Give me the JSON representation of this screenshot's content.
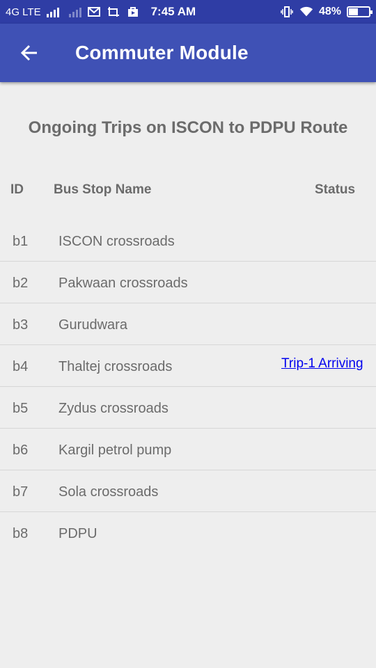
{
  "statusbar": {
    "network": "4G LTE",
    "time": "7:45 AM",
    "battery_percent": "48%",
    "battery_level": 0.48,
    "icons": [
      "signal-icon",
      "signal-dim-icon",
      "mail-icon",
      "screenshot-icon",
      "play-store-icon",
      "vibrate-icon",
      "wifi-icon",
      "battery-icon"
    ]
  },
  "appbar": {
    "title": "Commuter Module",
    "back_icon": "arrow-back-icon",
    "color": "#3f51b5"
  },
  "heading": "Ongoing Trips on ISCON to PDPU Route",
  "table": {
    "headers": {
      "id": "ID",
      "name": "Bus Stop Name",
      "status": "Status"
    },
    "rows": [
      {
        "id": "b1",
        "name": "ISCON crossroads",
        "status": ""
      },
      {
        "id": "b2",
        "name": "Pakwaan crossroads",
        "status": ""
      },
      {
        "id": "b3",
        "name": "Gurudwara",
        "status": ""
      },
      {
        "id": "b4",
        "name": "Thaltej crossroads",
        "status": "Trip-1 Arriving"
      },
      {
        "id": "b5",
        "name": "Zydus crossroads",
        "status": ""
      },
      {
        "id": "b6",
        "name": "Kargil petrol pump",
        "status": ""
      },
      {
        "id": "b7",
        "name": "Sola crossroads",
        "status": ""
      },
      {
        "id": "b8",
        "name": "PDPU",
        "status": ""
      }
    ]
  }
}
